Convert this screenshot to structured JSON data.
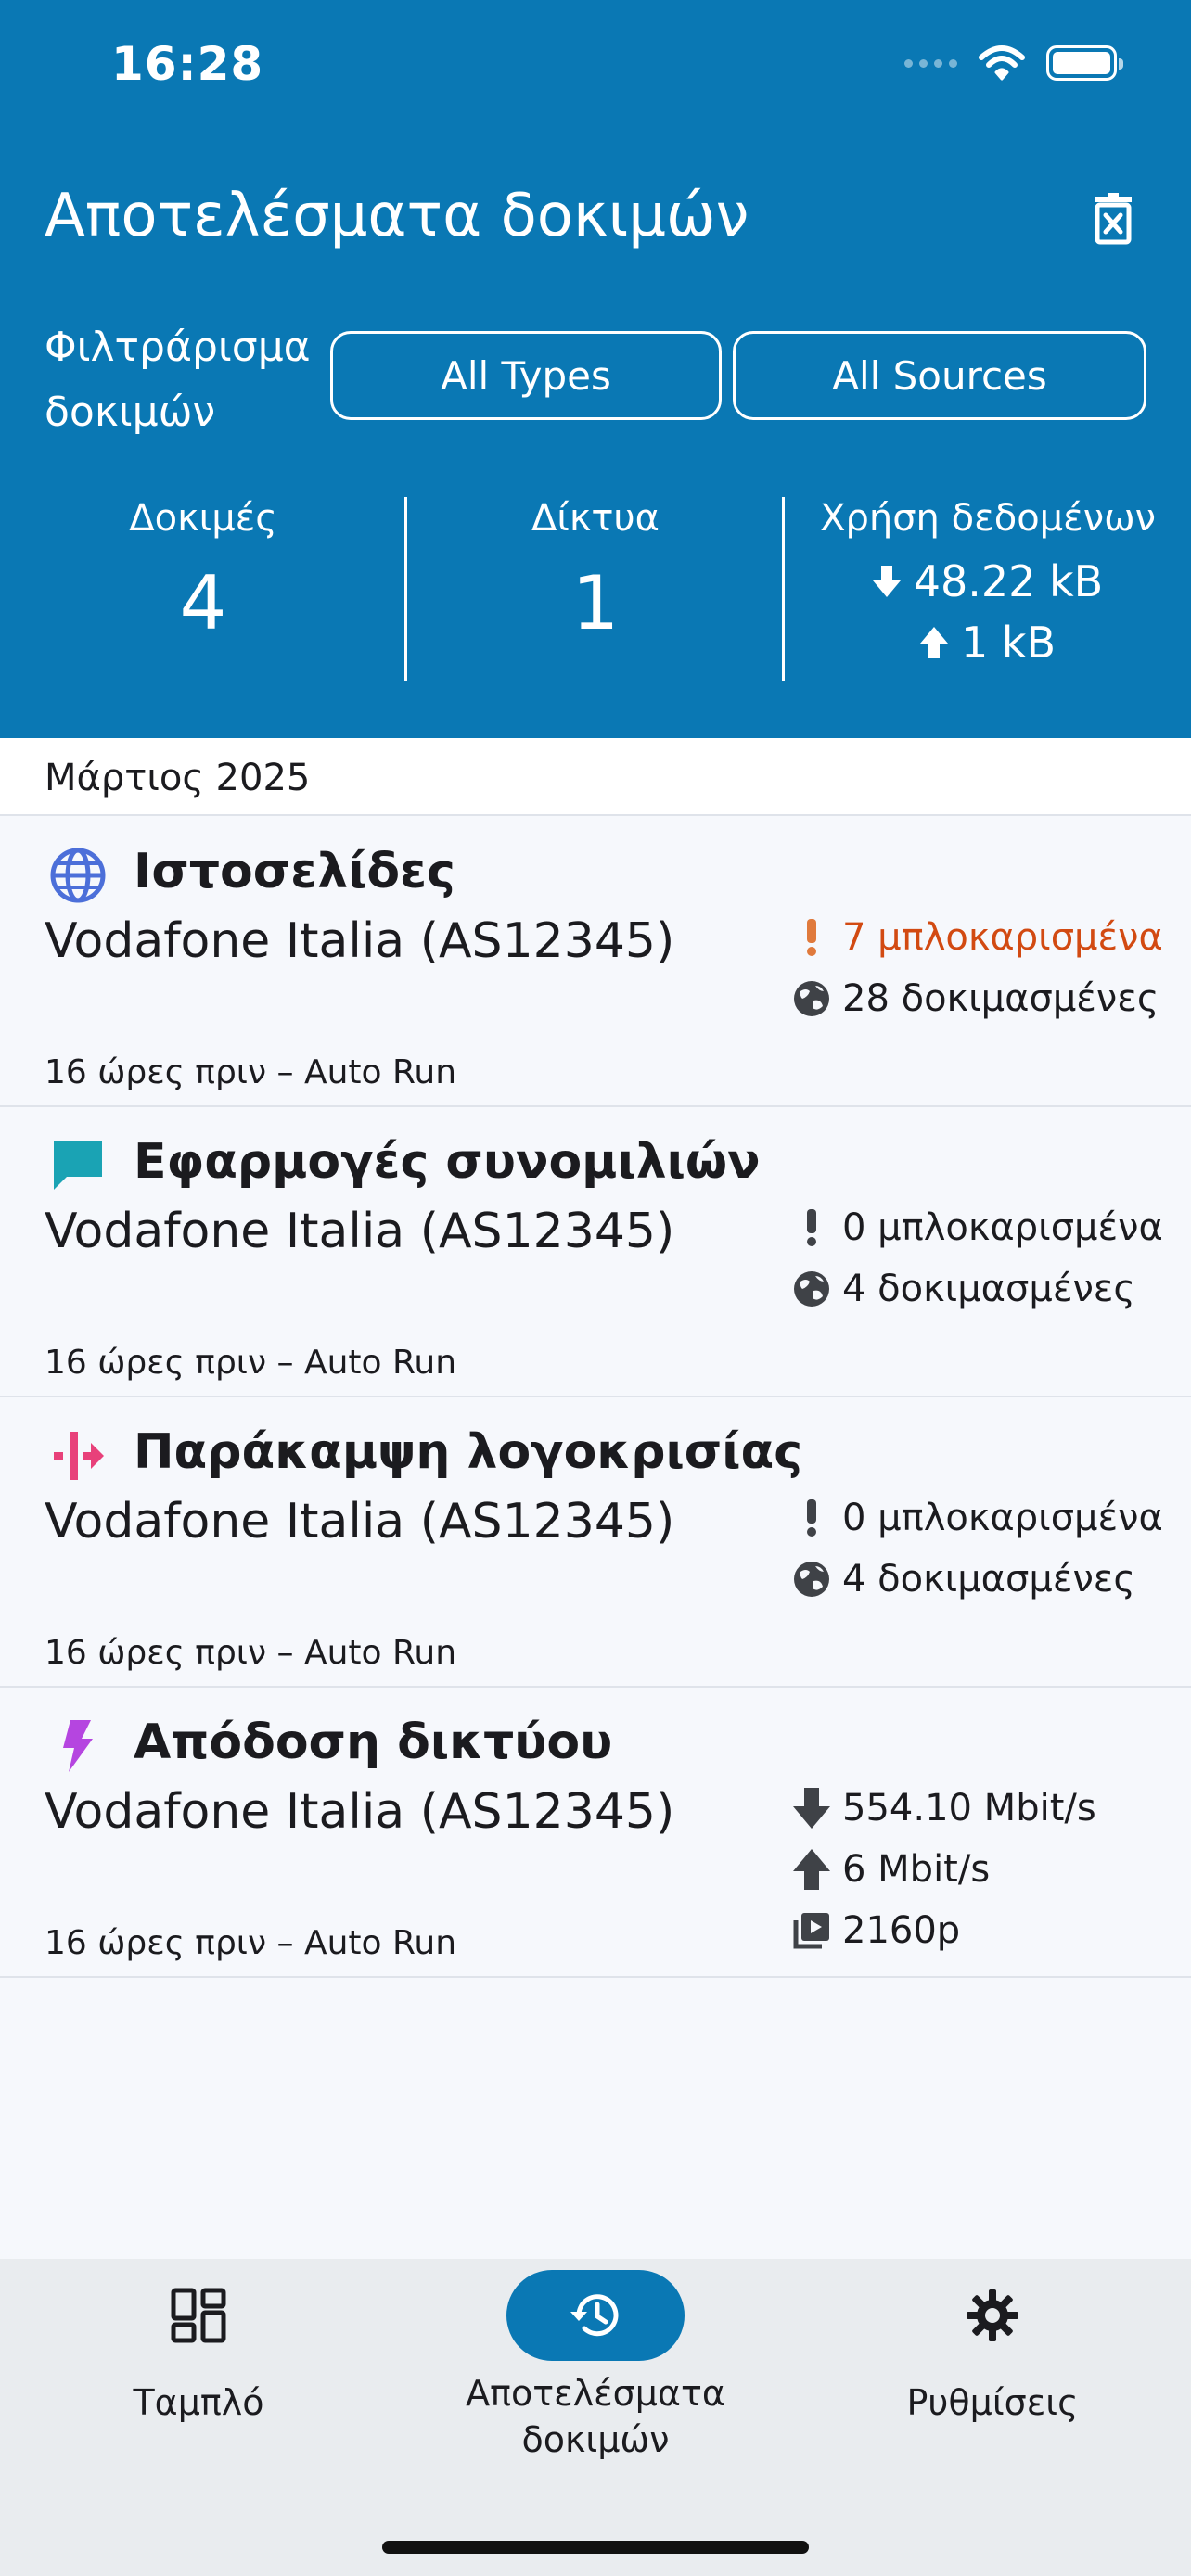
{
  "status_bar": {
    "time": "16:28"
  },
  "header": {
    "title": "Αποτελέσματα δοκιμών",
    "filter_label": "Φιλτράρισμα δοκιμών",
    "filter_types": "All Types",
    "filter_sources": "All Sources",
    "stats": {
      "tests_label": "Δοκιμές",
      "tests_value": "4",
      "networks_label": "Δίκτυα",
      "networks_value": "1",
      "data_label": "Χρήση δεδομένων",
      "download": "48.22 kB",
      "upload": "1 kB"
    }
  },
  "month": "Μάρτιος 2025",
  "results": [
    {
      "title": "Ιστοσελίδες",
      "network": "Vodafone Italia (AS12345)",
      "meta": "16 ώρες πριν – Auto Run",
      "icon": "globe-icon",
      "icon_color": "#4c6fd9",
      "blocked": "7 μπλοκαρισμένα",
      "tested": "28 δοκιμασμένες"
    },
    {
      "title": "Εφαρμογές συνομιλιών",
      "network": "Vodafone Italia (AS12345)",
      "meta": "16 ώρες πριν – Auto Run",
      "icon": "chat-icon",
      "icon_color": "#1aa3b4",
      "blocked": "0 μπλοκαρισμένα",
      "tested": "4 δοκιμασμένες"
    },
    {
      "title": "Παράκαμψη λογοκρισίας",
      "network": "Vodafone Italia (AS12345)",
      "meta": "16 ώρες πριν – Auto Run",
      "icon": "circumvention-icon",
      "icon_color": "#e8417a",
      "blocked": "0 μπλοκαρισμένα",
      "tested": "4 δοκιμασμένες"
    },
    {
      "title": "Απόδοση δικτύου",
      "network": "Vodafone Italia (AS12345)",
      "meta": "16 ώρες πριν – Auto Run",
      "icon": "lightning-icon",
      "icon_color": "#b545e0",
      "download": "554.10 Mbit/s",
      "upload": "6 Mbit/s",
      "video": "2160p"
    }
  ],
  "colors": {
    "header_bg": "#0a78b4",
    "blocked_warning": "#d24a12"
  },
  "nav": [
    {
      "label": "Ταμπλό",
      "icon": "dashboard-icon"
    },
    {
      "label": "Αποτελέσματα δοκιμών",
      "icon": "history-icon"
    },
    {
      "label": "Ρυθμίσεις",
      "icon": "gear-icon"
    }
  ]
}
